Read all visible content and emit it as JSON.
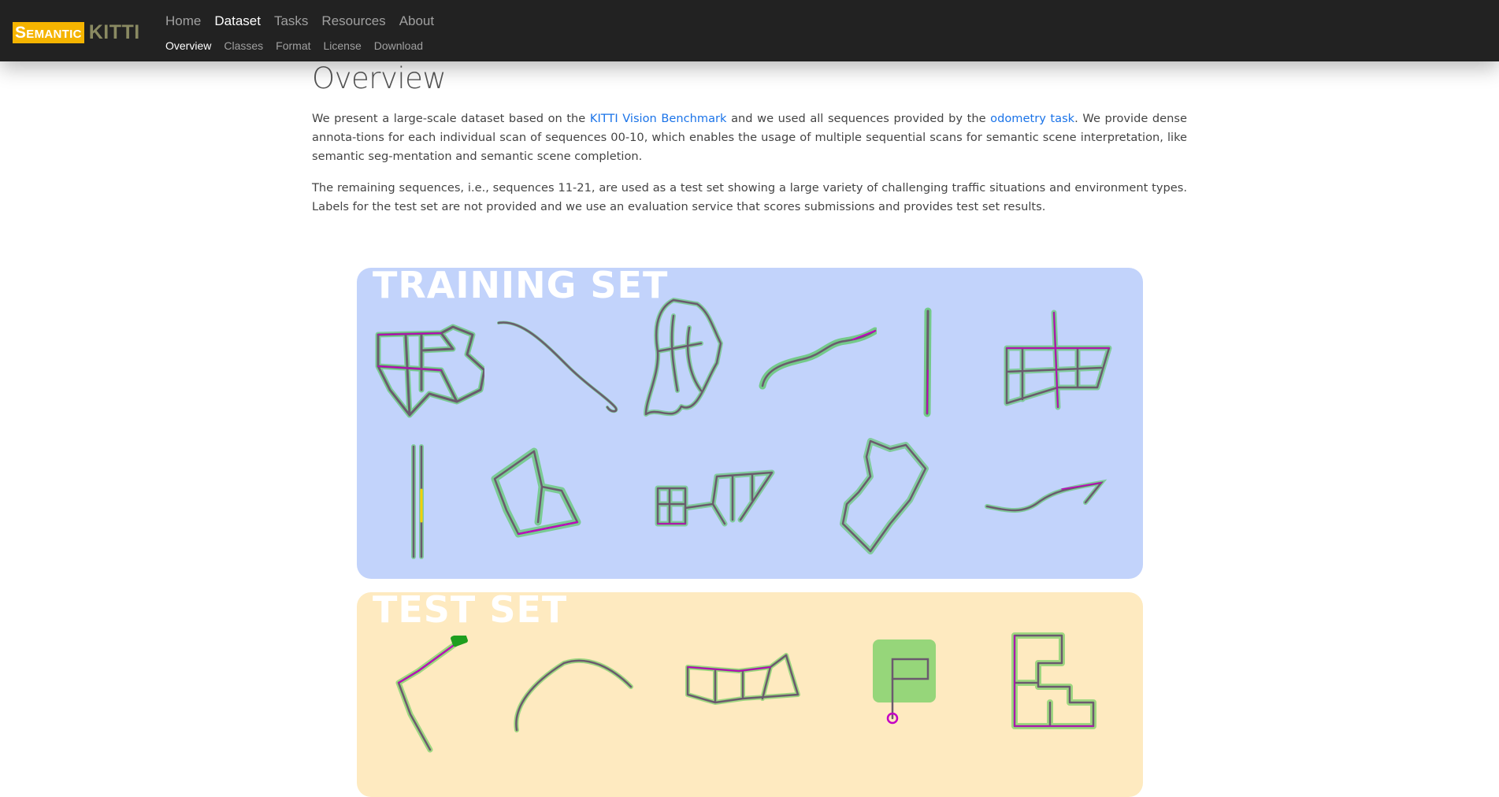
{
  "brand": {
    "logo_part1": "Semantic",
    "logo_part2": "KITTI"
  },
  "nav": {
    "main": [
      "Home",
      "Dataset",
      "Tasks",
      "Resources",
      "About"
    ],
    "active_main": "Dataset",
    "sub": [
      "Overview",
      "Classes",
      "Format",
      "License",
      "Download"
    ],
    "active_sub": "Overview"
  },
  "page": {
    "title": "Overview",
    "p1_a": "We present a large-scale dataset based on the ",
    "p1_link1": "KITTI Vision Benchmark",
    "p1_b": " and we used all sequences provided by the ",
    "p1_link2": "odometry task",
    "p1_c": ". We provide dense annota-tions for each individual scan of sequences 00-10, which enables the usage of multiple sequential scans for semantic scene interpretation, like semantic seg-mentation and semantic scene completion.",
    "p2": "The remaining sequences, i.e., sequences 11-21, are used as a test set showing a large variety of challenging traffic situations and environment types. Labels for the test set are not provided and we use an evaluation service that scores submissions and provides test set results."
  },
  "figure": {
    "training_title": "TRAINING SET",
    "test_title": "TEST SET"
  },
  "colors": {
    "navbar": "#222222",
    "logo_yellow": "#f5b400",
    "link": "#1a73e8",
    "training_bg": "#c2d3fb",
    "test_bg": "#feeac0",
    "track_line": "#6b5a6e",
    "track_magenta": "#c400c4",
    "track_green": "#3fc43f"
  }
}
